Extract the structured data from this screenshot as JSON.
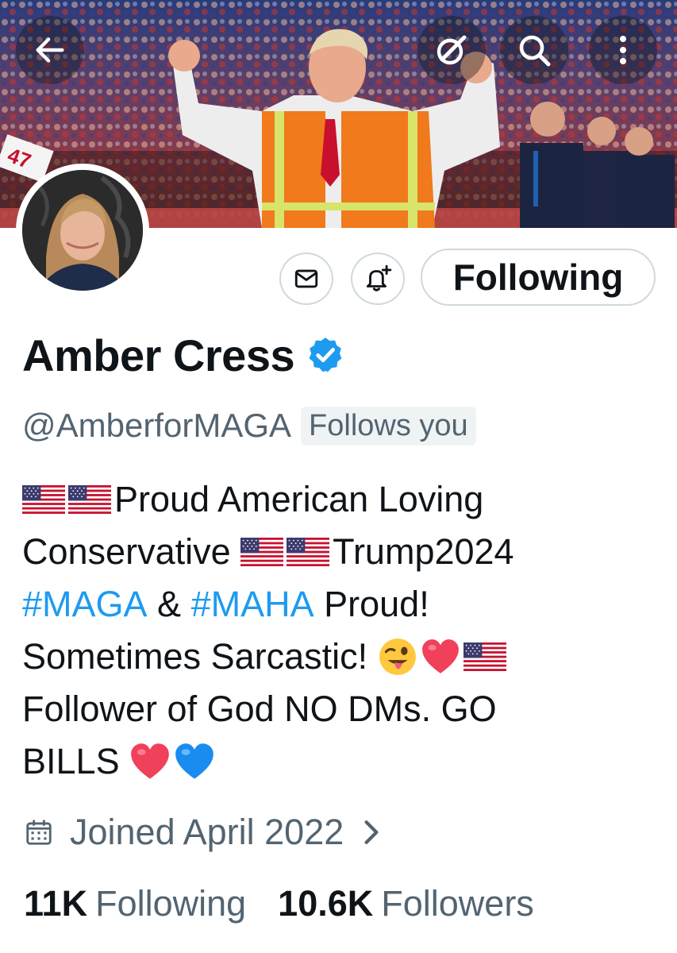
{
  "header": {
    "back_icon": "arrow-left-icon",
    "grok_icon": "grok-icon",
    "search_icon": "search-icon",
    "more_icon": "more-vertical-icon",
    "banner_jersey_number": "47"
  },
  "profile": {
    "display_name": "Amber Cress",
    "handle": "@AmberforMAGA",
    "follows_you": "Follows you",
    "verified": true,
    "verified_color": "#1d9bf0"
  },
  "actions": {
    "message_icon": "envelope-icon",
    "notify_icon": "bell-plus-icon",
    "following_label": "Following"
  },
  "bio": {
    "line1_text": "Proud American Loving",
    "line2_text_a": "Conservative ",
    "line2_text_b": "Trump2024",
    "line3_hashtag1": "#MAGA",
    "line3_amp": " & ",
    "line3_hashtag2": "#MAHA",
    "line3_text": " Proud!",
    "line4_text": "Sometimes Sarcastic! ",
    "line5_text": "Follower of God NO DMs. GO",
    "line6_text": "BILLS "
  },
  "joined": {
    "icon": "calendar-icon",
    "text": "Joined April 2022"
  },
  "stats": {
    "following_count": "11K",
    "following_label": "Following",
    "followers_count": "10.6K",
    "followers_label": "Followers"
  },
  "colors": {
    "accent": "#1d9bf0",
    "secondary_text": "#536471",
    "border": "#cfd9de"
  }
}
